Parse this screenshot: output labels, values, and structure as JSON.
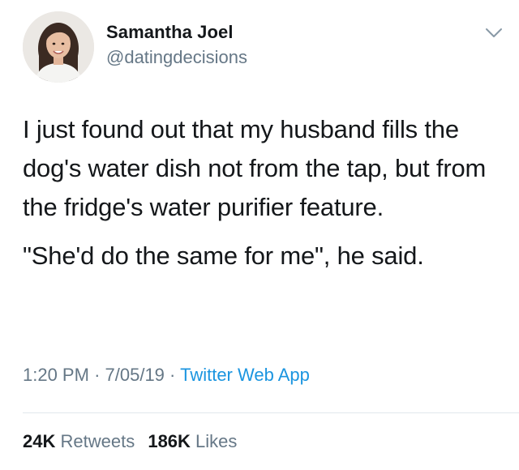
{
  "author": {
    "name": "Samantha Joel",
    "handle": "@datingdecisions"
  },
  "icons": {
    "menu": "chevron-down-icon",
    "avatar": "profile-photo"
  },
  "tweet": {
    "paragraphs": [
      "I just found out that my husband fills the dog's water dish not from the tap, but from the fridge's water purifier feature.",
      "\"She'd do the same for me\", he said."
    ]
  },
  "meta": {
    "time": "1:20 PM",
    "date": "7/05/19",
    "separator": "·",
    "source": "Twitter Web App"
  },
  "stats": {
    "retweets_count": "24K",
    "retweets_label": "Retweets",
    "likes_count": "186K",
    "likes_label": "Likes"
  },
  "colors": {
    "text": "#14171a",
    "secondary": "#657786",
    "link": "#1b95e0",
    "divider": "#e1e8ed"
  }
}
